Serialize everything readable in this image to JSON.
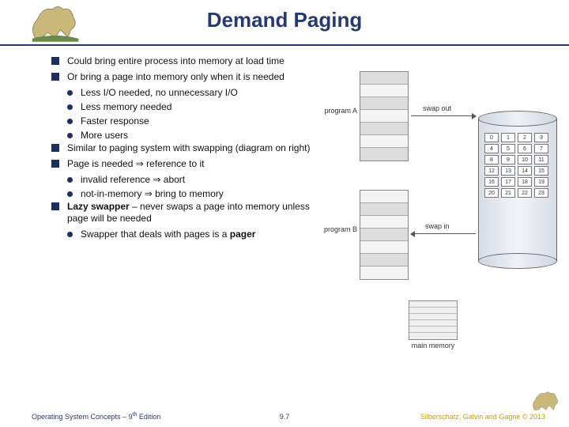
{
  "title": "Demand Paging",
  "bullets": [
    {
      "text": "Could bring entire process into memory at load time",
      "sub": []
    },
    {
      "text": "Or bring a page into memory only when it is needed",
      "sub": [
        {
          "text": "Less I/O needed, no unnecessary I/O"
        },
        {
          "text": "Less memory needed"
        },
        {
          "text": "Faster response"
        },
        {
          "text": "More users"
        }
      ]
    },
    {
      "text": "Similar to paging system with swapping (diagram on right)",
      "sub": []
    },
    {
      "html": "Page is needed <span class='arrow'></span> reference to it",
      "sub": [
        {
          "html": "invalid reference <span class='arrow'></span> abort"
        },
        {
          "html": "not-in-memory <span class='arrow'></span> bring to memory"
        }
      ]
    },
    {
      "html": "<span class='bold'>Lazy swapper</span> – never swaps a page into memory unless page will be needed",
      "sub": [
        {
          "html": "Swapper that deals with pages is a <span class='bold'>pager</span>"
        }
      ]
    }
  ],
  "diagram": {
    "programA": "program A",
    "programB": "program B",
    "mainMemory": "main memory",
    "swapOut": "swap out",
    "swapIn": "swap in",
    "pages": [
      "0",
      "1",
      "2",
      "3",
      "4",
      "5",
      "6",
      "7",
      "8",
      "9",
      "10",
      "11",
      "12",
      "13",
      "14",
      "15",
      "16",
      "17",
      "18",
      "19",
      "20",
      "21",
      "22",
      "23"
    ]
  },
  "footer": {
    "left_a": "Operating System Concepts – 9",
    "left_b": " Edition",
    "left_sup": "th",
    "mid": "9.7",
    "right": "Silberschatz, Galvin and Gagne © 2013"
  }
}
